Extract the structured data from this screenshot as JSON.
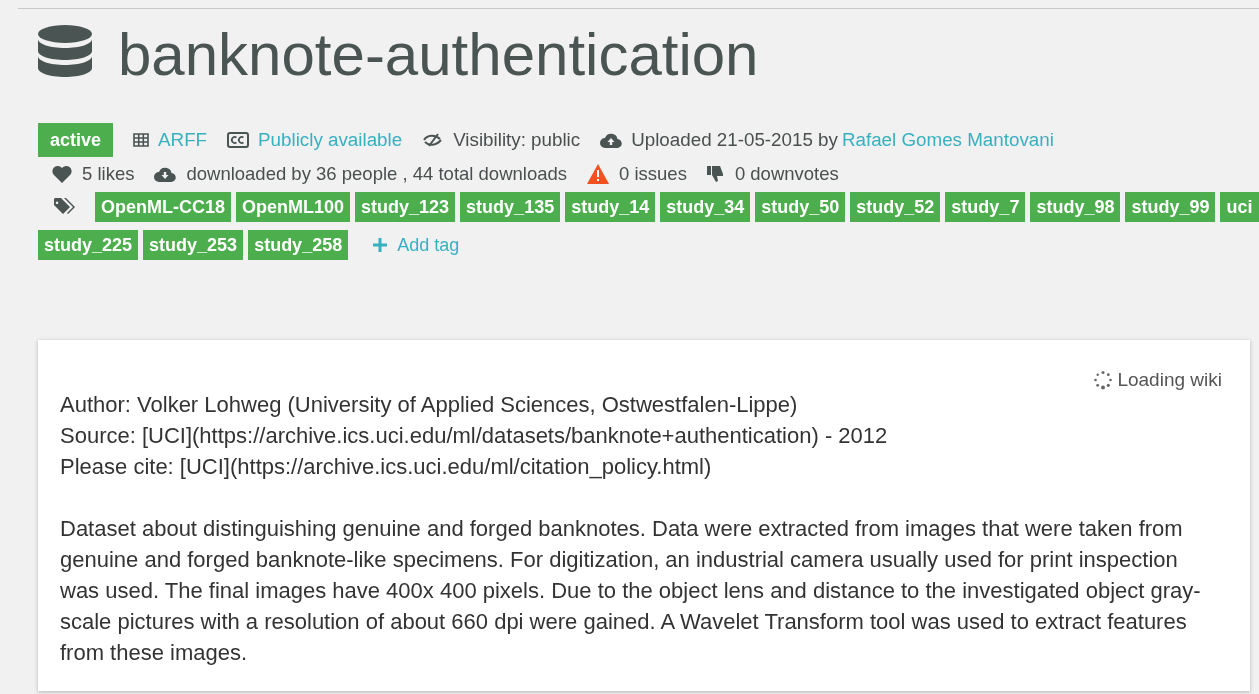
{
  "title": "banknote-authentication",
  "status": {
    "label": "active"
  },
  "meta": [
    {
      "kind": "format",
      "text": "ARFF",
      "link": true
    },
    {
      "kind": "license",
      "text": "Publicly available",
      "link": true
    },
    {
      "kind": "visibility",
      "text": "Visibility: public",
      "link": false
    },
    {
      "kind": "upload",
      "text": "Uploaded 21-05-2015 by",
      "author": "Rafael Gomes Mantovani"
    }
  ],
  "stats": [
    {
      "kind": "likes",
      "text": "5 likes"
    },
    {
      "kind": "downloads",
      "text": "downloaded by 36 people , 44 total downloads"
    },
    {
      "kind": "issues",
      "text": "0 issues"
    },
    {
      "kind": "downvotes",
      "text": "0 downvotes"
    }
  ],
  "tags": [
    "OpenML-CC18",
    "OpenML100",
    "study_123",
    "study_135",
    "study_14",
    "study_34",
    "study_50",
    "study_52",
    "study_7",
    "study_98",
    "study_99",
    "uci",
    "study_225",
    "study_253",
    "study_258"
  ],
  "add_tag": "Add tag",
  "wiki": {
    "loading": "Loading wiki",
    "header_lines": [
      "Author: Volker Lohweg (University of Applied Sciences, Ostwestfalen-Lippe)",
      "Source: [UCI](https://archive.ics.uci.edu/ml/datasets/banknote+authentication) - 2012",
      "Please cite: [UCI](https://archive.ics.uci.edu/ml/citation_policy.html)"
    ],
    "description": "Dataset about distinguishing genuine and forged banknotes. Data were extracted from images that were taken from genuine and forged banknote-like specimens. For digitization, an industrial camera usually used for print inspection was used. The final images have 400x 400 pixels. Due to the object lens and distance to the investigated object gray-scale pictures with a resolution of about 660 dpi were gained. A Wavelet Transform tool was used to extract features from these images."
  }
}
